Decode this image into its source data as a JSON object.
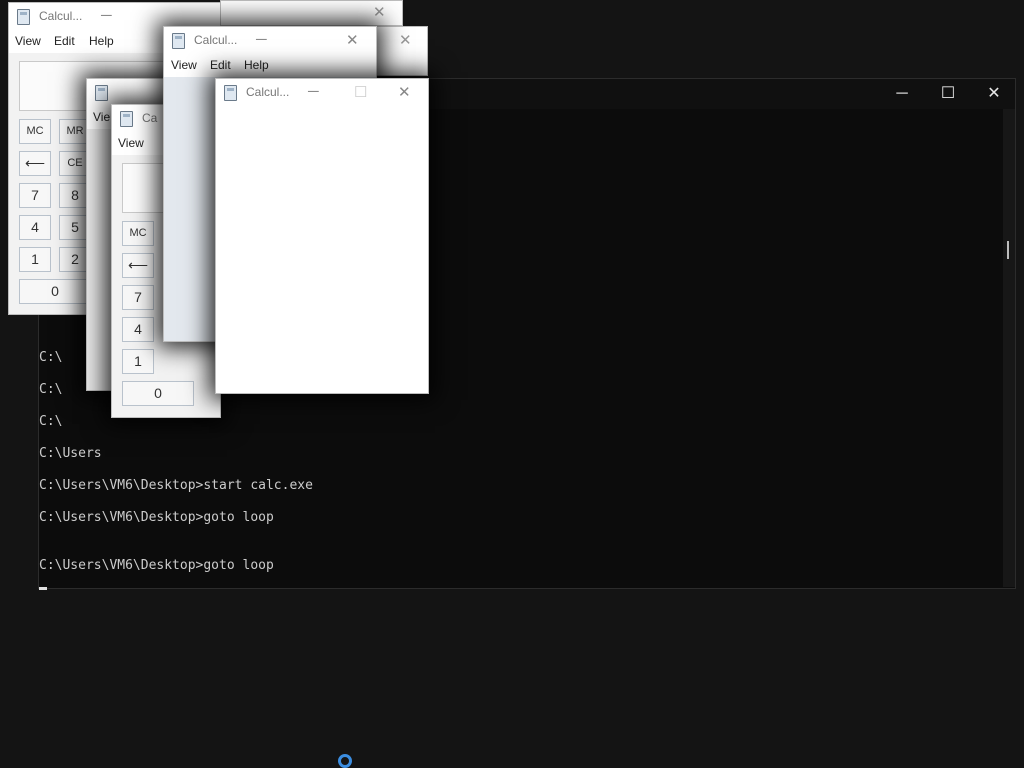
{
  "console": {
    "lines": [
      {
        "text": "C:\\"
      },
      {
        "text": "C:\\"
      },
      {
        "text": "C:\\"
      },
      {
        "text": "C:\\Users"
      },
      {
        "text": "C:\\Users\\VM6\\Desktop>start calc.exe"
      },
      {
        "text": "C:\\Users\\VM6\\Desktop>goto loop"
      },
      {
        "text": "C:\\Users\\VM6\\Desktop>goto loop"
      }
    ],
    "minimize_glyph": "─",
    "maximize_glyph": "☐",
    "close_glyph": "✕"
  },
  "calc": {
    "title": "Calcul...",
    "menu": [
      "View",
      "Edit",
      "Help"
    ],
    "minimize_glyph": "─",
    "maximize_glyph": "☐",
    "close_glyph": "✕",
    "keys": {
      "mc": "MC",
      "mr": "MR",
      "back": "⟵",
      "ce": "CE",
      "seven": "7",
      "eight": "8",
      "four": "4",
      "five": "5",
      "one": "1",
      "two": "2",
      "zero": "0"
    },
    "partial": {
      "title_frag": "Ca",
      "view": "Vie"
    }
  },
  "taskbar": {
    "icon": "cortana-ring-icon"
  }
}
